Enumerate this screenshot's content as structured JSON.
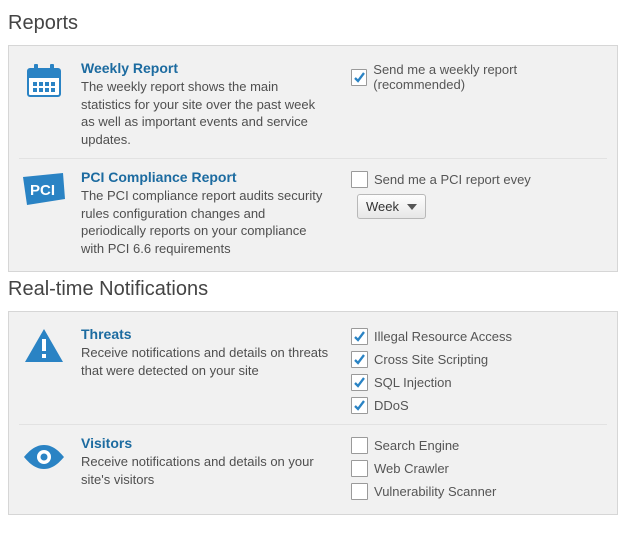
{
  "sections": {
    "reports": {
      "heading": "Reports",
      "weekly": {
        "title": "Weekly Report",
        "desc": "The weekly report shows the main statistics for your site over the past week as well as important events and service updates.",
        "checkbox_label": "Send me a weekly report (recommended)",
        "checked": true
      },
      "pci": {
        "title": "PCI Compliance Report",
        "desc": "The PCI compliance report audits security rules configuration changes and periodically reports on your compliance with PCI 6.6 requirements",
        "checkbox_label": "Send me a PCI report evey",
        "checked": false,
        "select_value": "Week"
      }
    },
    "realtime": {
      "heading": "Real-time Notifications",
      "threats": {
        "title": "Threats",
        "desc": "Receive notifications and details on threats that were detected on your site",
        "options": [
          {
            "label": "Illegal Resource Access",
            "checked": true
          },
          {
            "label": "Cross Site Scripting",
            "checked": true
          },
          {
            "label": "SQL Injection",
            "checked": true
          },
          {
            "label": "DDoS",
            "checked": true
          }
        ]
      },
      "visitors": {
        "title": "Visitors",
        "desc": "Receive notifications and details on your site's visitors",
        "options": [
          {
            "label": "Search Engine",
            "checked": false
          },
          {
            "label": "Web Crawler",
            "checked": false
          },
          {
            "label": "Vulnerability Scanner",
            "checked": false
          }
        ]
      }
    }
  }
}
